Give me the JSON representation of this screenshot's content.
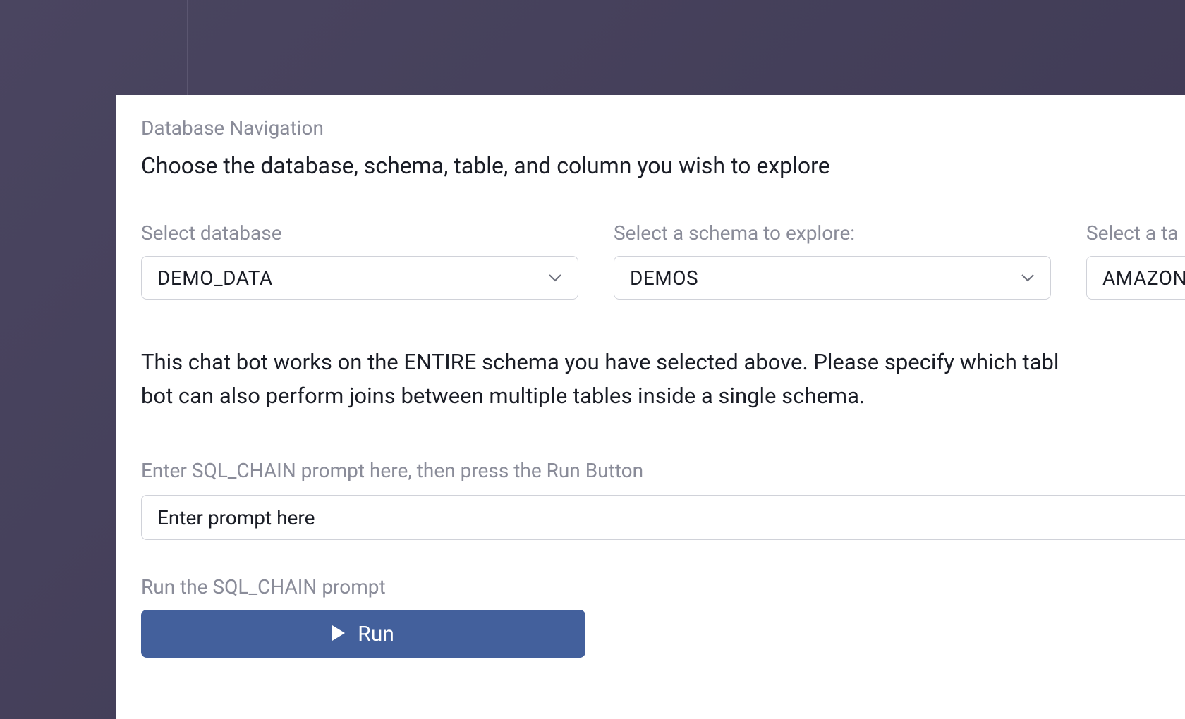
{
  "nav": {
    "section_label": "Database Navigation",
    "section_title": "Choose the database, schema, table, and column you wish to explore"
  },
  "selectors": {
    "database": {
      "label": "Select database",
      "value": "DEMO_DATA"
    },
    "schema": {
      "label": "Select a schema to explore:",
      "value": "DEMOS"
    },
    "table": {
      "label": "Select a ta",
      "value": "AMAZON"
    }
  },
  "description_line1": "This chat bot works on the ENTIRE schema you have selected above. Please specify which tabl",
  "description_line2": "bot can also perform joins between multiple tables inside a single schema.",
  "prompt": {
    "label": "Enter SQL_CHAIN prompt here, then press the Run Button",
    "placeholder": "Enter prompt here"
  },
  "run": {
    "label": "Run the SQL_CHAIN prompt",
    "button_text": "Run"
  },
  "colors": {
    "accent": "#43609c",
    "muted": "#8a8c99",
    "text": "#1a1d26",
    "border": "#d0d2d9"
  }
}
